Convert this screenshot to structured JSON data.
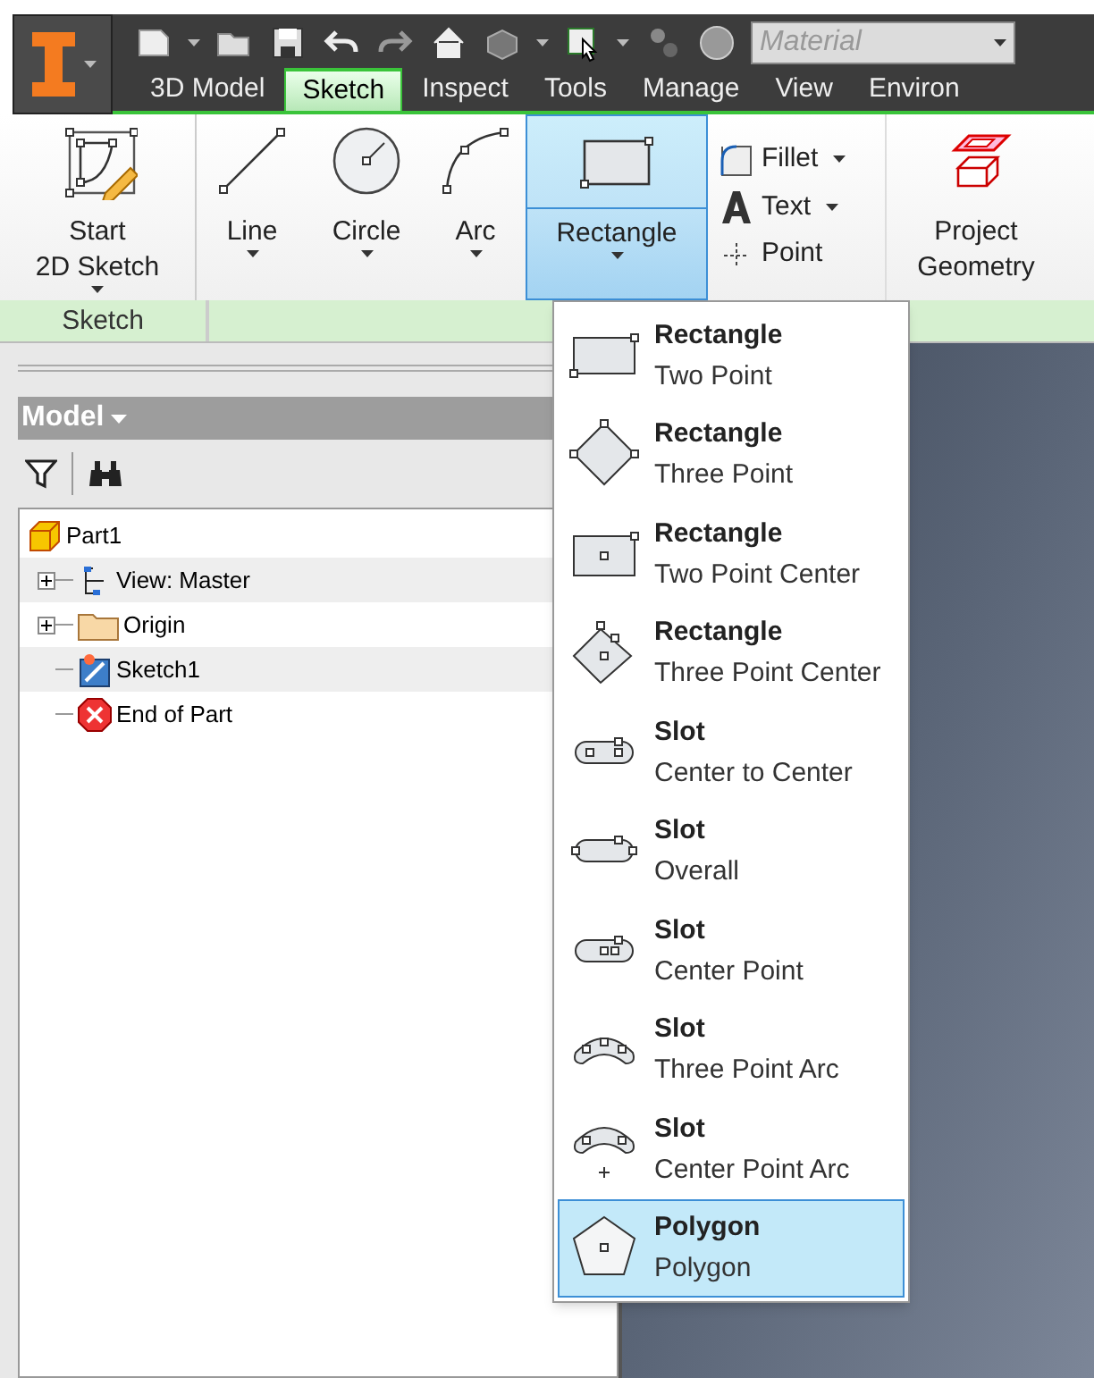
{
  "material_field": {
    "placeholder": "Material"
  },
  "tabs": [
    {
      "label": "3D Model",
      "selected": false
    },
    {
      "label": "Sketch",
      "selected": true
    },
    {
      "label": "Inspect",
      "selected": false
    },
    {
      "label": "Tools",
      "selected": false
    },
    {
      "label": "Manage",
      "selected": false
    },
    {
      "label": "View",
      "selected": false
    },
    {
      "label": "Environ",
      "selected": false
    }
  ],
  "ribbon": {
    "tools": [
      {
        "kind": "start-sketch",
        "lines": [
          "Start",
          "2D Sketch"
        ],
        "has_menu": true,
        "selected": false
      },
      {
        "kind": "line",
        "lines": [
          "Line"
        ],
        "has_menu": true,
        "selected": false
      },
      {
        "kind": "circle",
        "lines": [
          "Circle"
        ],
        "has_menu": true,
        "selected": false
      },
      {
        "kind": "arc",
        "lines": [
          "Arc"
        ],
        "has_menu": true,
        "selected": false
      },
      {
        "kind": "rectangle",
        "lines": [
          "Rectangle"
        ],
        "has_menu": true,
        "selected": true
      },
      {
        "kind": "small",
        "items": [
          {
            "kind": "fillet",
            "label": "Fillet",
            "has_menu": true
          },
          {
            "kind": "text",
            "label": "Text",
            "has_menu": true
          },
          {
            "kind": "point",
            "label": "Point",
            "has_menu": false
          }
        ]
      },
      {
        "kind": "project",
        "lines": [
          "Project",
          "Geometry"
        ],
        "has_menu": false,
        "selected": false
      }
    ],
    "panel_labels": [
      "Sketch"
    ]
  },
  "browser": {
    "title": "Model",
    "tree": [
      {
        "label": "Part1",
        "kind": "part",
        "children": [
          {
            "label": "View: Master",
            "kind": "view",
            "expanded": false
          },
          {
            "label": "Origin",
            "kind": "folder",
            "expanded": false
          },
          {
            "label": "Sketch1",
            "kind": "sketch"
          },
          {
            "label": "End of Part",
            "kind": "end"
          }
        ]
      }
    ]
  },
  "menu": [
    {
      "kind": "rect-two",
      "title": "Rectangle",
      "subtitle": "Two Point",
      "selected": false
    },
    {
      "kind": "rect-three",
      "title": "Rectangle",
      "subtitle": "Three Point",
      "selected": false
    },
    {
      "kind": "rect-center",
      "title": "Rectangle",
      "subtitle": "Two Point Center",
      "selected": false
    },
    {
      "kind": "rect-three-center",
      "title": "Rectangle",
      "subtitle": "Three Point Center",
      "selected": false
    },
    {
      "kind": "slot-cc",
      "title": "Slot",
      "subtitle": "Center to Center",
      "selected": false
    },
    {
      "kind": "slot-overall",
      "title": "Slot",
      "subtitle": "Overall",
      "selected": false
    },
    {
      "kind": "slot-center",
      "title": "Slot",
      "subtitle": "Center Point",
      "selected": false
    },
    {
      "kind": "slot-arc3",
      "title": "Slot",
      "subtitle": "Three Point Arc",
      "selected": false
    },
    {
      "kind": "slot-arc-center",
      "title": "Slot",
      "subtitle": "Center Point Arc",
      "selected": false
    },
    {
      "kind": "polygon",
      "title": "Polygon",
      "subtitle": "Polygon",
      "selected": true
    }
  ]
}
